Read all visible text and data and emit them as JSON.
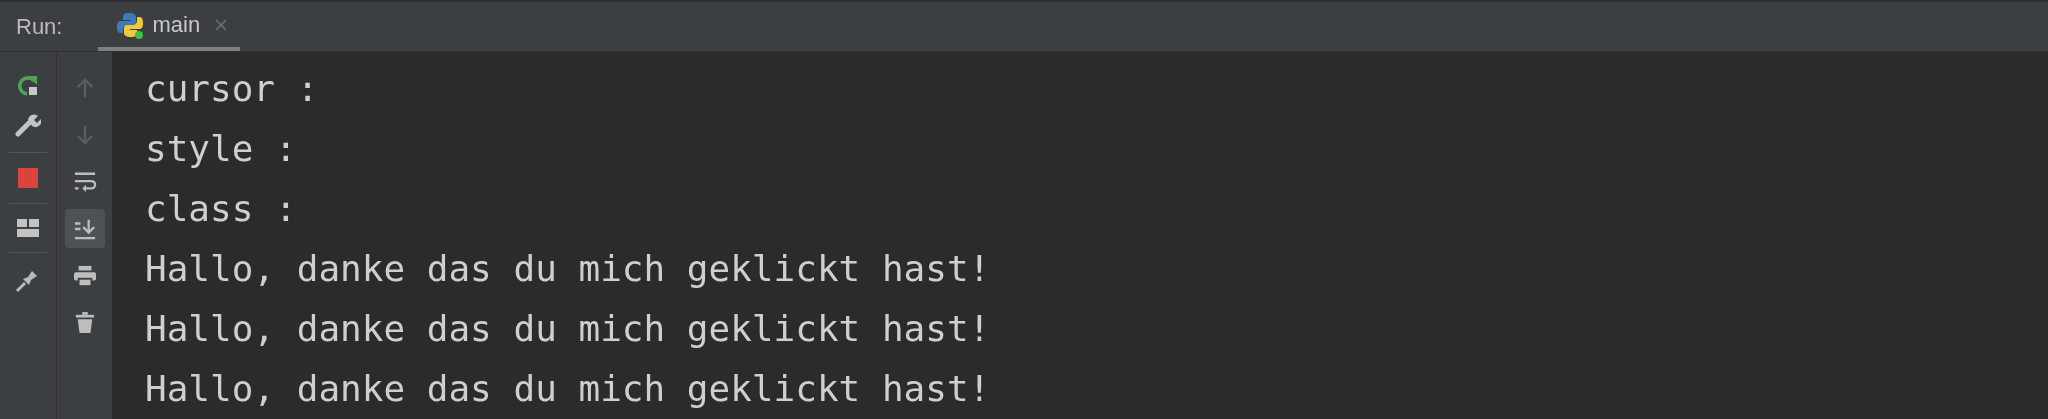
{
  "run_panel": {
    "title": "Run:",
    "tabs": [
      {
        "label": "main",
        "selected": true
      }
    ]
  },
  "main_toolbar": [
    {
      "kind": "rerun"
    },
    {
      "kind": "wrench"
    },
    {
      "kind": "divider"
    },
    {
      "kind": "stop"
    },
    {
      "kind": "divider"
    },
    {
      "kind": "layout"
    },
    {
      "kind": "divider"
    },
    {
      "kind": "pin"
    }
  ],
  "console_toolbar": [
    {
      "kind": "up",
      "disabled": true,
      "on": false
    },
    {
      "kind": "down",
      "disabled": true,
      "on": false
    },
    {
      "kind": "wrap",
      "disabled": false,
      "on": false
    },
    {
      "kind": "scroll_end",
      "disabled": false,
      "on": true
    },
    {
      "kind": "print",
      "disabled": false,
      "on": false
    },
    {
      "kind": "trash",
      "disabled": false,
      "on": false
    }
  ],
  "console_lines": [
    "cursor :",
    "style :",
    "class :",
    "Hallo, danke das du mich geklickt hast!",
    "Hallo, danke das du mich geklickt hast!",
    "Hallo, danke das du mich geklickt hast!"
  ]
}
